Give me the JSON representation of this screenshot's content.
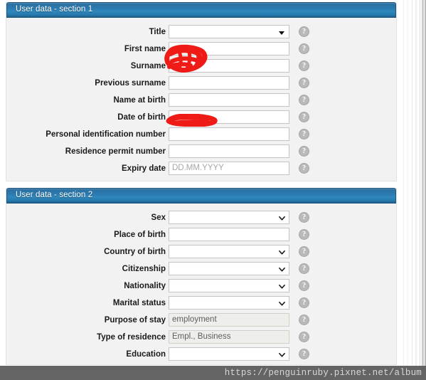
{
  "sections": [
    {
      "title": "User data - section 1",
      "rows": [
        {
          "label": "Title",
          "required": false,
          "control": "select-triangle",
          "value": "",
          "placeholder": "",
          "readonly": false,
          "help": "?"
        },
        {
          "label": "First name",
          "required": true,
          "control": "text",
          "value": "",
          "placeholder": "",
          "readonly": false,
          "help": "?"
        },
        {
          "label": "Surname",
          "required": true,
          "control": "text",
          "value": "",
          "placeholder": "",
          "readonly": false,
          "help": "?"
        },
        {
          "label": "Previous surname",
          "required": false,
          "control": "text",
          "value": "",
          "placeholder": "",
          "readonly": false,
          "help": "?"
        },
        {
          "label": "Name at birth",
          "required": true,
          "control": "text",
          "value": "",
          "placeholder": "",
          "readonly": false,
          "help": "?"
        },
        {
          "label": "Date of birth",
          "required": true,
          "control": "text",
          "value": "",
          "placeholder": "",
          "readonly": false,
          "help": "?"
        },
        {
          "label": "Personal identification number",
          "required": false,
          "control": "text",
          "value": "",
          "placeholder": "",
          "readonly": false,
          "help": "?"
        },
        {
          "label": "Residence permit number",
          "required": true,
          "control": "text",
          "value": "",
          "placeholder": "",
          "readonly": false,
          "help": "?"
        },
        {
          "label": "Expiry date",
          "required": false,
          "control": "text",
          "value": "",
          "placeholder": "DD.MM.YYYY",
          "readonly": false,
          "help": "?"
        }
      ]
    },
    {
      "title": "User data - section 2",
      "rows": [
        {
          "label": "Sex",
          "required": true,
          "control": "select-chevron",
          "value": "",
          "placeholder": "",
          "readonly": false,
          "help": "?"
        },
        {
          "label": "Place of birth",
          "required": true,
          "control": "text",
          "value": "",
          "placeholder": "",
          "readonly": false,
          "help": "?"
        },
        {
          "label": "Country of birth",
          "required": true,
          "control": "select-chevron",
          "value": "",
          "placeholder": "",
          "readonly": false,
          "help": "?"
        },
        {
          "label": "Citizenship",
          "required": true,
          "control": "select-chevron",
          "value": "",
          "placeholder": "",
          "readonly": false,
          "help": "?"
        },
        {
          "label": "Nationality",
          "required": true,
          "control": "select-chevron",
          "value": "",
          "placeholder": "",
          "readonly": false,
          "help": "?"
        },
        {
          "label": "Marital status",
          "required": true,
          "control": "select-chevron",
          "value": "",
          "placeholder": "",
          "readonly": false,
          "help": "?"
        },
        {
          "label": "Purpose of stay",
          "required": true,
          "control": "text",
          "value": "employment",
          "placeholder": "",
          "readonly": true,
          "help": "?"
        },
        {
          "label": "Type of residence",
          "required": true,
          "control": "text",
          "value": "Empl., Business",
          "placeholder": "",
          "readonly": true,
          "help": "?"
        },
        {
          "label": "Education",
          "required": true,
          "control": "select-chevron",
          "value": "",
          "placeholder": "",
          "readonly": false,
          "help": "?"
        }
      ]
    }
  ],
  "required_marker": "*",
  "redactions": [
    {
      "name": "first-name-surname-redaction",
      "color": "#ee1b16"
    },
    {
      "name": "date-of-birth-redaction",
      "color": "#ee1b16"
    }
  ],
  "watermark": {
    "text": "https://penguinruby.pixnet.net/album"
  },
  "colors": {
    "header_blue_top": "#2e6e9e",
    "header_blue_mid": "#2f88bd",
    "header_blue_bottom": "#1d5f8a",
    "panel_background": "#f2f2f2",
    "field_border": "#c4c4c4",
    "readonly_field_background": "#eeeeea",
    "help_icon": "#b9b9b9",
    "watermark_bar": "#646464",
    "redaction_red": "#ee1b16"
  }
}
